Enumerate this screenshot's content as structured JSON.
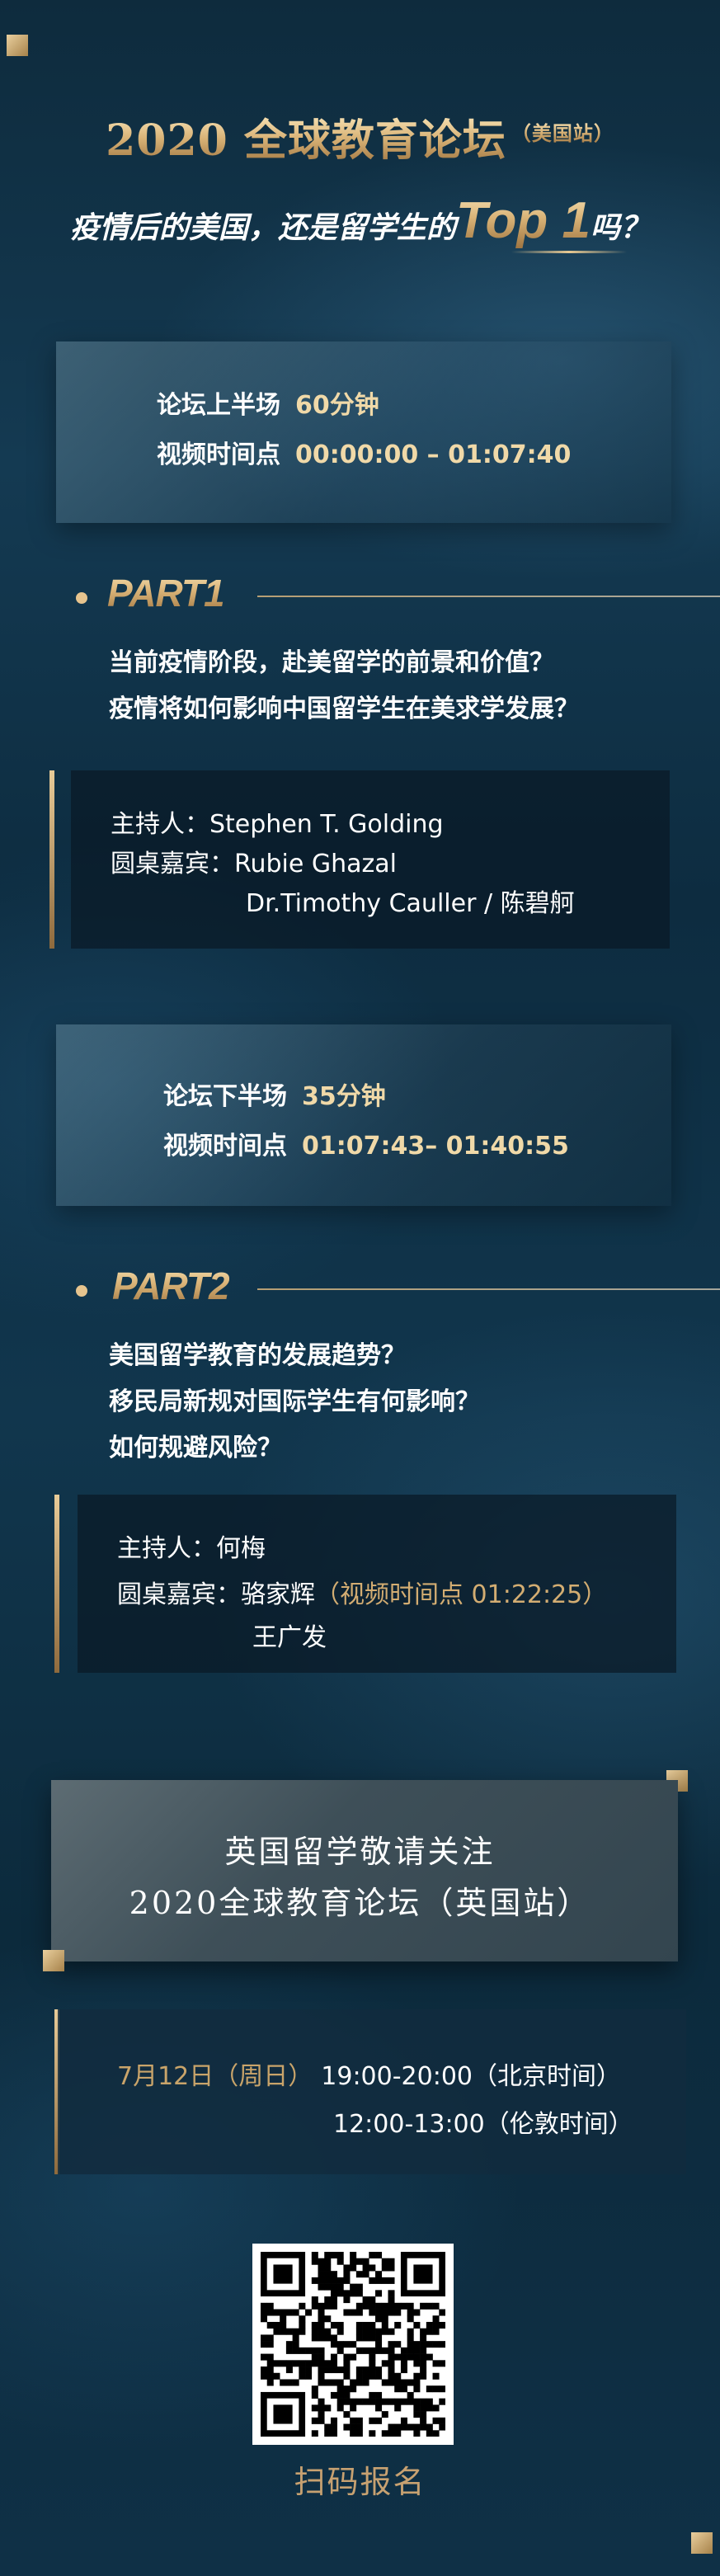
{
  "header": {
    "title": "2020 全球教育论坛",
    "title_sub": "（美国站）",
    "headline_pre": "疫情后的美国，还是留学生的",
    "headline_top": "Top 1",
    "headline_post": "吗？"
  },
  "first_half": {
    "label": "论坛上半场",
    "duration": "60分钟",
    "time_label": "视频时间点",
    "time_range": "00:00:00 – 01:07:40"
  },
  "part1": {
    "title": "PART1",
    "questions": [
      "当前疫情阶段，赴美留学的前景和价值？",
      "疫情将如何影响中国留学生在美求学发展？"
    ],
    "host_label": "主持人：",
    "host": "Stephen T. Golding",
    "guests_label": "圆桌嘉宾：",
    "guests_line1": "Rubie Ghazal",
    "guests_line2": "Dr.Timothy Cauller / 陈碧舸"
  },
  "second_half": {
    "label": "论坛下半场",
    "duration": "35分钟",
    "time_label": "视频时间点",
    "time_range": "01:07:43– 01:40:55"
  },
  "part2": {
    "title": "PART2",
    "questions": [
      "美国留学教育的发展趋势？",
      "移民局新规对国际学生有何影响？",
      "如何规避风险？"
    ],
    "host_label": "主持人：",
    "host": "何梅",
    "guests_label": "圆桌嘉宾：",
    "guests_line1": "骆家辉",
    "guests_line1_note": "（视频时间点 01:22:25）",
    "guests_line2": "王广发"
  },
  "uk_promo": {
    "line1": "英国留学敬请关注",
    "line2": "2020全球教育论坛（英国站）"
  },
  "schedule": {
    "date": "7月12日（周日）",
    "beijing": "19:00-20:00（北京时间）",
    "london": "12:00-13:00（伦敦时间）"
  },
  "qr": {
    "icon": "qr-code-icon",
    "cta": "扫码报名"
  },
  "colors": {
    "accent_gold": "#d3ad72",
    "background": "#11364d"
  }
}
